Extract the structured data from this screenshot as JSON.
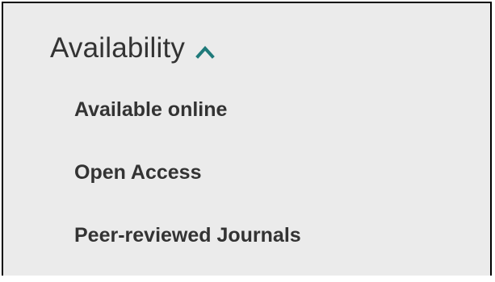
{
  "availability": {
    "title": "Availability",
    "chevron_icon": "chevron-up-icon",
    "accent_color": "#1f7a7a",
    "items": [
      {
        "label": "Available online"
      },
      {
        "label": "Open Access"
      },
      {
        "label": "Peer-reviewed Journals"
      }
    ]
  }
}
